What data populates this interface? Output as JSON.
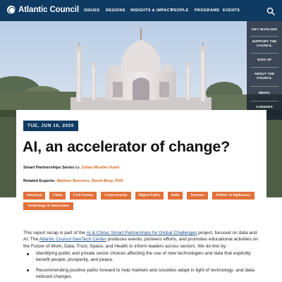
{
  "header": {
    "logo_text": "Atlantic Council",
    "nav": [
      "ISSUES",
      "REGIONS",
      "INSIGHTS & IMPACT",
      "PEOPLE",
      "PROGRAMS",
      "EVENTS"
    ],
    "search_icon": "search-icon",
    "colors": {
      "bar": "#0f3a62"
    }
  },
  "rail": {
    "items": [
      [
        "GET INVOLVED"
      ],
      [
        "SUPPORT THE",
        "COUNCIL"
      ],
      [
        "SIGN UP"
      ],
      [
        "ABOUT THE",
        "COUNCIL"
      ],
      [
        "MEDIA"
      ],
      [
        "CAREERS"
      ]
    ]
  },
  "article": {
    "date": "TUE, JUN 16, 2020",
    "title": "AI, an accelerator of change?",
    "series_label": "Smart Partnerships Series",
    "series_by": "by",
    "author": "Julian Mueller-Kaler",
    "experts_label": "Related Experts:",
    "experts": "Mathew Burrows, David Bray, PhD",
    "tags": [
      "American",
      "China",
      "Civil Society",
      "Cybersecurity",
      "Digital Policy",
      "India",
      "Internet",
      "Politics & Diplomacy",
      "Technology & Innovation"
    ],
    "tag_color": "#e2703a",
    "accent_color": "#d4691f",
    "body": {
      "part1": "This report recap is part of the ",
      "link1": "AI & China: Smart Partnerships for Global Challenges",
      "part2": " project, focused on data and AI. The ",
      "link2": "Atlantic Council GeoTech Center",
      "part3": " produces events, pioneers efforts, and promotes educational activities on the Future of Work, Data, Trust, Space, and Health to inform leaders across sectors. We do this by:"
    },
    "bullets": [
      "Identifying public and private sector choices affecting the use of new technologies and data that explicitly benefit people, prosperity, and peace.",
      "Recommending positive paths forward to help markets and societies adapt in light of technology- and data-induced changes."
    ]
  }
}
